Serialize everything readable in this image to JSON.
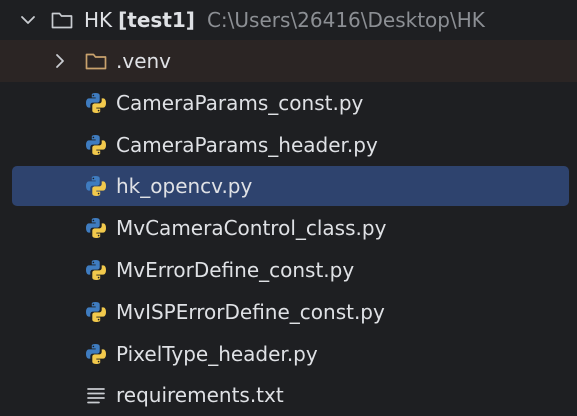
{
  "project": {
    "name": "HK",
    "module": "[test1]",
    "path": "C:\\Users\\26416\\Desktop\\HK"
  },
  "folder": {
    "name": ".venv"
  },
  "files": [
    {
      "name": "CameraParams_const.py",
      "icon": "python-icon"
    },
    {
      "name": "CameraParams_header.py",
      "icon": "python-icon"
    },
    {
      "name": "hk_opencv.py",
      "icon": "python-icon",
      "selected": true
    },
    {
      "name": "MvCameraControl_class.py",
      "icon": "python-icon"
    },
    {
      "name": "MvErrorDefine_const.py",
      "icon": "python-icon"
    },
    {
      "name": "MvISPErrorDefine_const.py",
      "icon": "python-icon"
    },
    {
      "name": "PixelType_header.py",
      "icon": "python-icon"
    },
    {
      "name": "requirements.txt",
      "icon": "text-file-icon"
    }
  ],
  "colors": {
    "background": "#1e1f22",
    "selection": "#2e436e",
    "venv_row": "#2b2524",
    "text": "#dfe1e5",
    "path_text": "#8c8f94",
    "folder": "#c9a26d",
    "python_blue": "#3f7cc0",
    "python_yellow": "#f2c94c"
  }
}
